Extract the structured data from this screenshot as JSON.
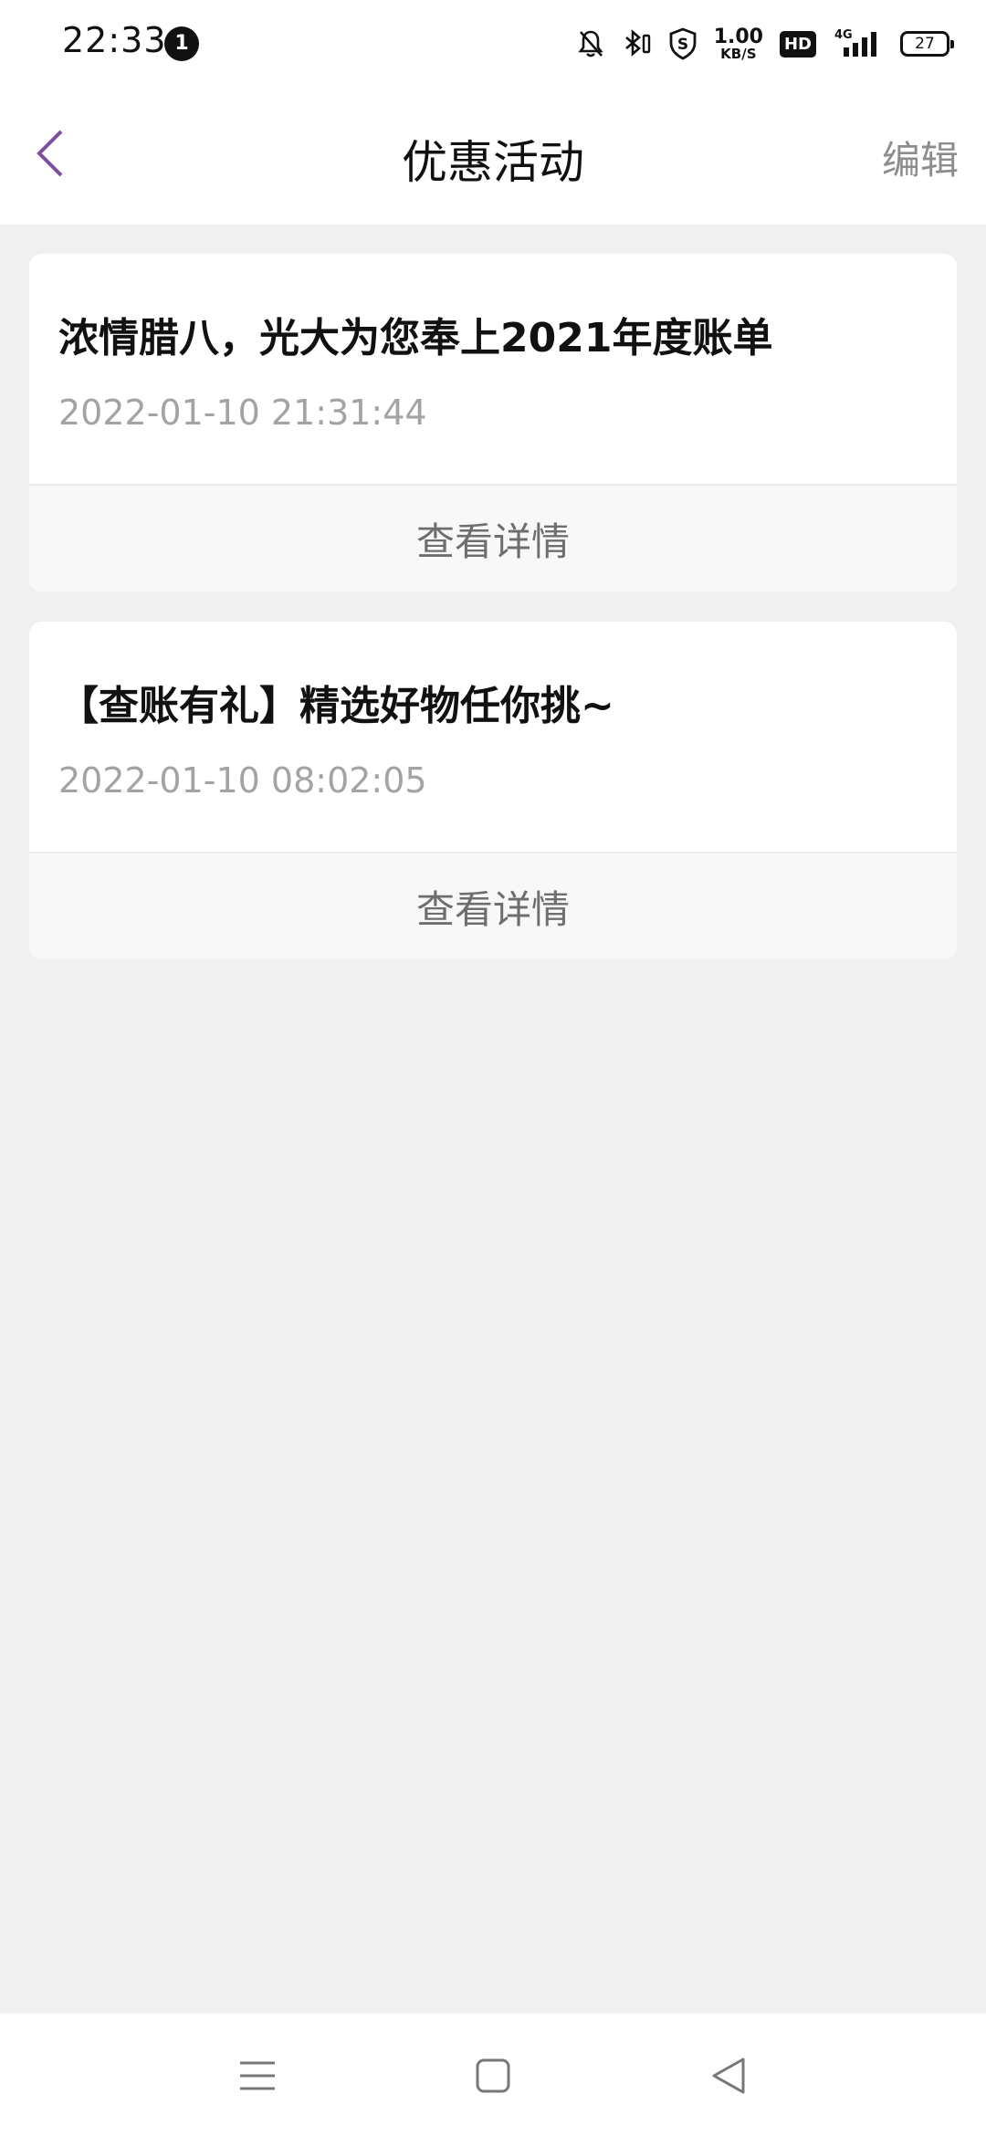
{
  "status_bar": {
    "time": "22:33",
    "notification_count": "1",
    "network_speed": "1.00",
    "network_speed_unit": "KB/S",
    "hd_label": "HD",
    "signal_label": "4G",
    "battery": "27",
    "icons": [
      "mute-bell-icon",
      "bluetooth-icon",
      "shield-icon",
      "hd-icon",
      "signal-icon",
      "battery-icon"
    ]
  },
  "header": {
    "title": "优惠活动",
    "edit_label": "编辑",
    "accent_color": "#7b4fa0"
  },
  "cards": [
    {
      "title": "浓情腊八，光大为您奉上2021年度账单",
      "time": "2022-01-10 21:31:44",
      "action": "查看详情"
    },
    {
      "title": "【查账有礼】精选好物任你挑~",
      "time": "2022-01-10 08:02:05",
      "action": "查看详情"
    }
  ],
  "nav_bar": {
    "icons": [
      "menu-icon",
      "home-icon",
      "back-triangle-icon"
    ]
  }
}
